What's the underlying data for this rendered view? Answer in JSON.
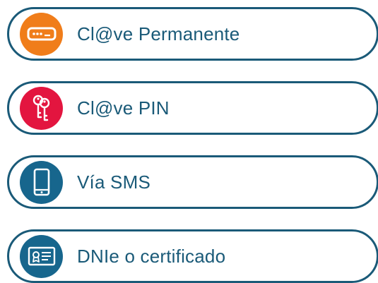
{
  "options": [
    {
      "label": "Cl@ve Permanente",
      "icon": "password-field-icon",
      "color": "#f07d1a"
    },
    {
      "label": "Cl@ve PIN",
      "icon": "keys-icon",
      "color": "#e3153f"
    },
    {
      "label": "Vía SMS",
      "icon": "mobile-phone-icon",
      "color": "#17668d"
    },
    {
      "label": "DNIe o certificado",
      "icon": "id-card-certificate-icon",
      "color": "#17668d"
    }
  ]
}
